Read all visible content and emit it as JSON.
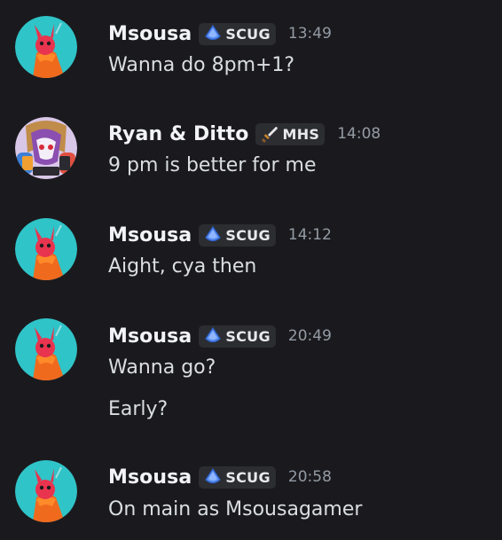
{
  "messages": [
    {
      "author": "Msousa",
      "tag": "SCUG",
      "tag_icon": "blue-gem-icon",
      "time": "13:49",
      "lines": [
        "Wanna do 8pm+1?"
      ]
    },
    {
      "author": "Ryan & Ditto",
      "tag": "MHS",
      "tag_icon": "sword-icon",
      "time": "14:08",
      "lines": [
        "9 pm is better for me"
      ]
    },
    {
      "author": "Msousa",
      "tag": "SCUG",
      "tag_icon": "blue-gem-icon",
      "time": "14:12",
      "lines": [
        "Aight, cya then"
      ]
    },
    {
      "author": "Msousa",
      "tag": "SCUG",
      "tag_icon": "blue-gem-icon",
      "time": "20:49",
      "lines": [
        "Wanna go?",
        "Early?"
      ]
    },
    {
      "author": "Msousa",
      "tag": "SCUG",
      "tag_icon": "blue-gem-icon",
      "time": "20:58",
      "lines": [
        "On main as Msousagamer"
      ]
    }
  ],
  "colors": {
    "background": "#1a1a1e",
    "username": "#f2f3f5",
    "message_text": "#dbdee1",
    "timestamp": "#949ba4",
    "tag_bg": "#2c2d31",
    "avatar_msousa_bg": "#2fc4c8"
  }
}
